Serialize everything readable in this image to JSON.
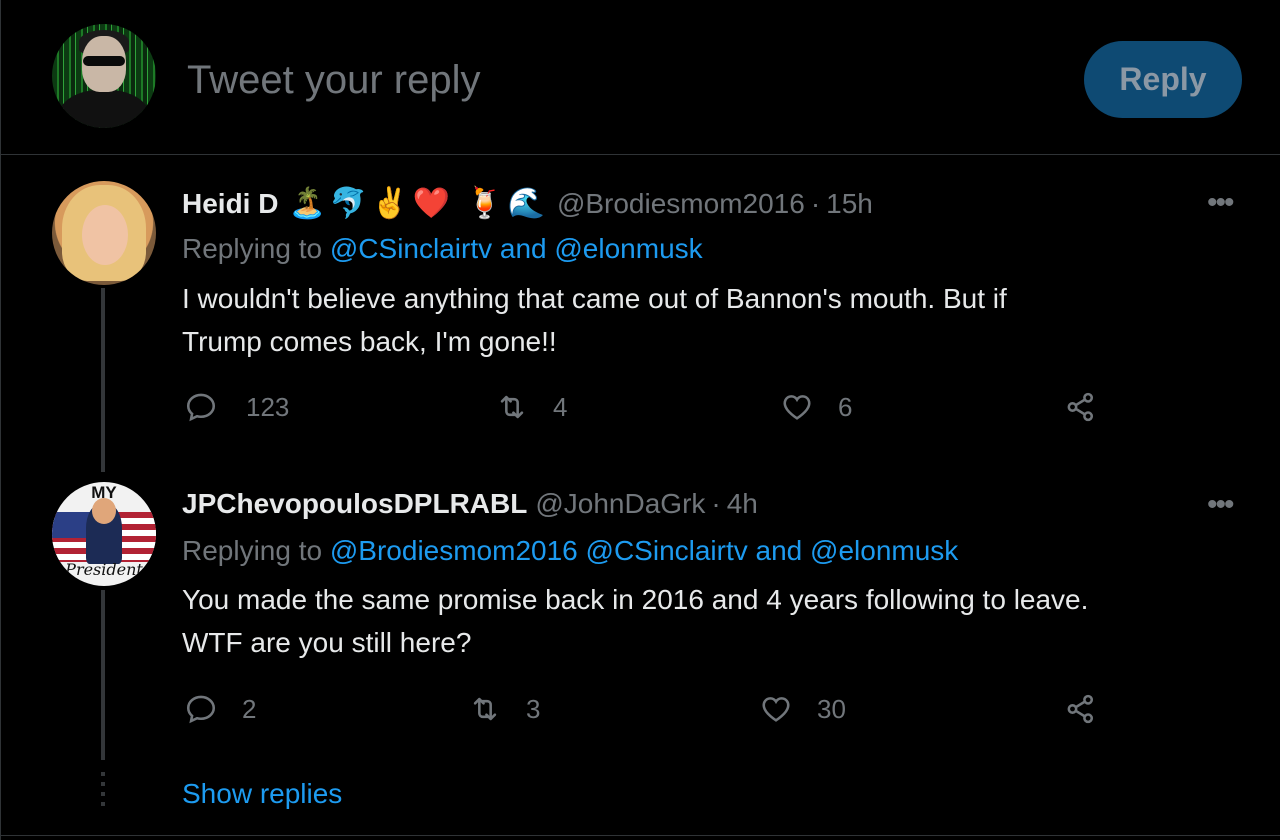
{
  "composer": {
    "placeholder": "Tweet your reply",
    "reply_label": "Reply"
  },
  "tweets": [
    {
      "display_name": "Heidi D",
      "emojis": "🏝️🐬✌️❤️ 🍹🌊",
      "handle": "@Brodiesmom2016",
      "time": "15h",
      "replying_prefix": "Replying to",
      "replying_mentions": "@CSinclairtv and @elonmusk",
      "text_line1": "I wouldn't believe anything that came out of Bannon's mouth.  But if",
      "text_line2": "Trump comes back, I'm gone!!",
      "replies": "123",
      "retweets": "4",
      "likes": "6"
    },
    {
      "display_name": "JPChevopoulosDPLRABL",
      "handle": "@JohnDaGrk",
      "time": "4h",
      "avatar_top": "MY",
      "avatar_bottom": "President",
      "replying_prefix": "Replying to",
      "replying_mentions": "@Brodiesmom2016 @CSinclairtv and @elonmusk",
      "text_line1": "You made the same promise back in 2016 and 4 years following to leave.",
      "text_line2": "WTF are you still here?",
      "replies": "2",
      "retweets": "3",
      "likes": "30"
    }
  ],
  "show_replies": "Show replies",
  "colors": {
    "background": "#000000",
    "text": "#e7e9ea",
    "secondary": "#71767b",
    "accent": "#1d9bf0",
    "reply_button": "#0e4a73"
  }
}
